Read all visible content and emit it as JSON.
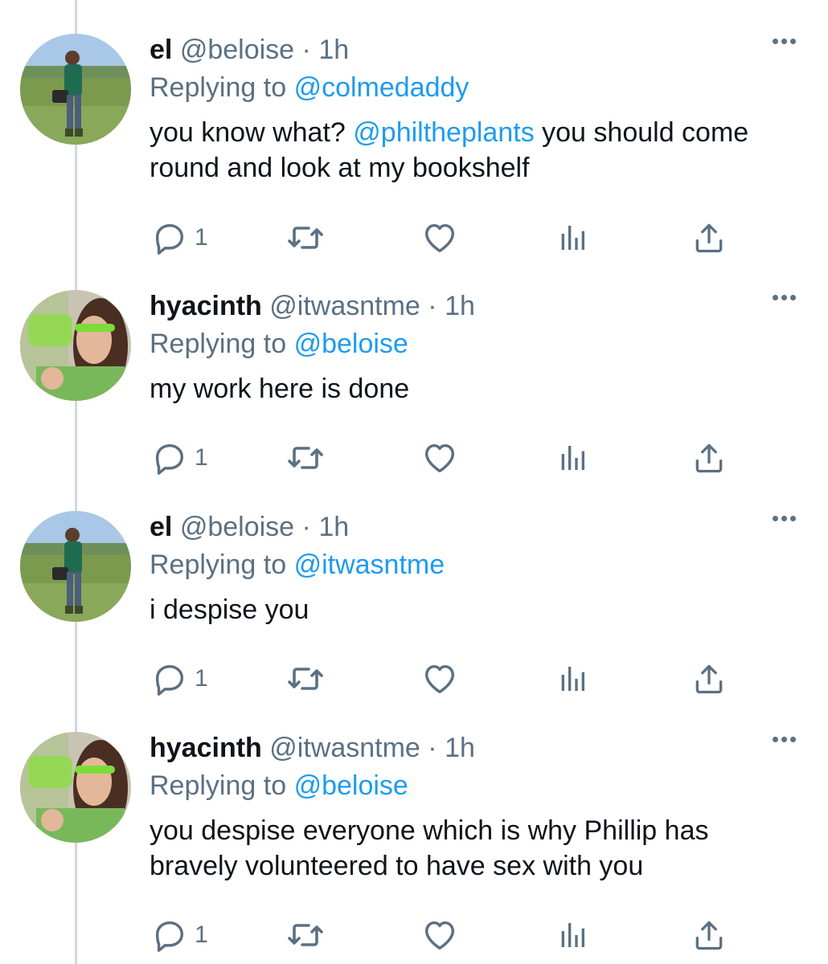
{
  "colors": {
    "link": "#1d9bf0",
    "muted": "#5b7083",
    "text": "#0f1419",
    "thread_line": "#cfd9de"
  },
  "tweets": [
    {
      "name": "el",
      "handle": "@beloise",
      "sep": "·",
      "time": "1h",
      "replying_label": "Replying to",
      "replying_to": "@colmedaddy",
      "text_parts": {
        "a": "you know what? ",
        "mention": "@philtheplants",
        "b": " you should come round and look at my bookshelf"
      },
      "reply_count": "1",
      "avatar_icon": "avatar-el"
    },
    {
      "name": "hyacinth",
      "handle": "@itwasntme",
      "sep": "·",
      "time": "1h",
      "replying_label": "Replying to",
      "replying_to": "@beloise",
      "text": "my work here is done",
      "reply_count": "1",
      "avatar_icon": "avatar-hyacinth"
    },
    {
      "name": "el",
      "handle": "@beloise",
      "sep": "·",
      "time": "1h",
      "replying_label": "Replying to",
      "replying_to": "@itwasntme",
      "text": "i despise you",
      "reply_count": "1",
      "avatar_icon": "avatar-el"
    },
    {
      "name": "hyacinth",
      "handle": "@itwasntme",
      "sep": "·",
      "time": "1h",
      "replying_label": "Replying to",
      "replying_to": "@beloise",
      "text": "you despise everyone which is why Phillip has bravely volunteered to have sex with you",
      "reply_count": "1",
      "avatar_icon": "avatar-hyacinth"
    }
  ],
  "action_icons": [
    "reply-icon",
    "retweet-icon",
    "like-icon",
    "analytics-icon",
    "share-icon"
  ]
}
